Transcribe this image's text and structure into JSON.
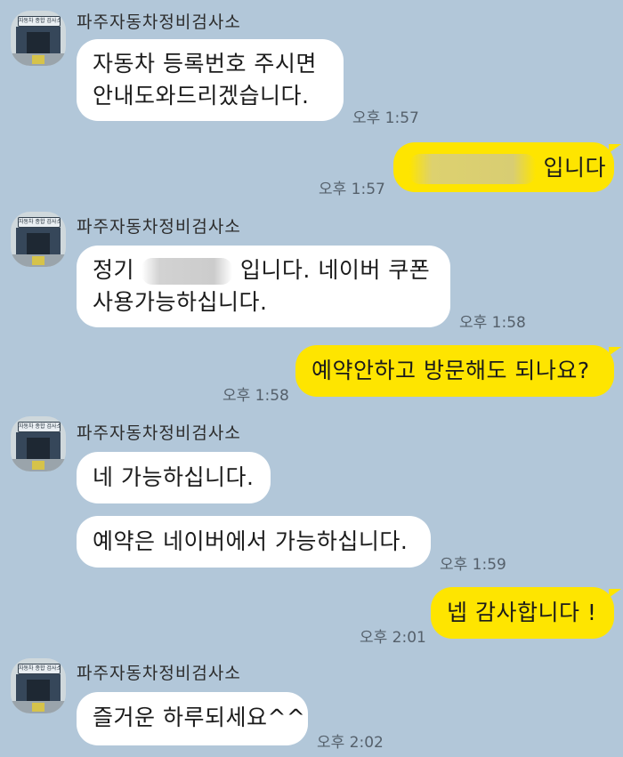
{
  "sender_name": "파주자동차정비검사소",
  "avatar_sign": "자동차 종합 검사소",
  "colors": {
    "background": "#b2c7d9",
    "incoming_bubble": "#ffffff",
    "outgoing_bubble": "#fee500"
  },
  "messages": [
    {
      "id": "m1",
      "dir": "in",
      "lines": [
        "자동차 등록번호 주시면",
        "안내도와드리겠습니다."
      ],
      "time": "오후 1:57"
    },
    {
      "id": "m2",
      "dir": "out",
      "text_suffix": "입니다",
      "redacted": true,
      "time": "오후 1:57"
    },
    {
      "id": "m3",
      "dir": "in",
      "line1_prefix": "정기",
      "line1_suffix": "입니다. 네이버 쿠폰",
      "line2": "사용가능하십니다.",
      "redacted": true,
      "time": "오후 1:58"
    },
    {
      "id": "m4",
      "dir": "out",
      "text": "예약안하고 방문해도 되나요?",
      "time": "오후 1:58"
    },
    {
      "id": "m5",
      "dir": "in",
      "text": "네 가능하십니다."
    },
    {
      "id": "m6",
      "dir": "in",
      "text": "예약은 네이버에서 가능하십니다.",
      "time": "오후 1:59"
    },
    {
      "id": "m7",
      "dir": "out",
      "text": "넵 감사합니다 !",
      "time": "오후 2:01"
    },
    {
      "id": "m8",
      "dir": "in",
      "text": "즐거운 하루되세요^^",
      "time": "오후 2:02"
    }
  ]
}
